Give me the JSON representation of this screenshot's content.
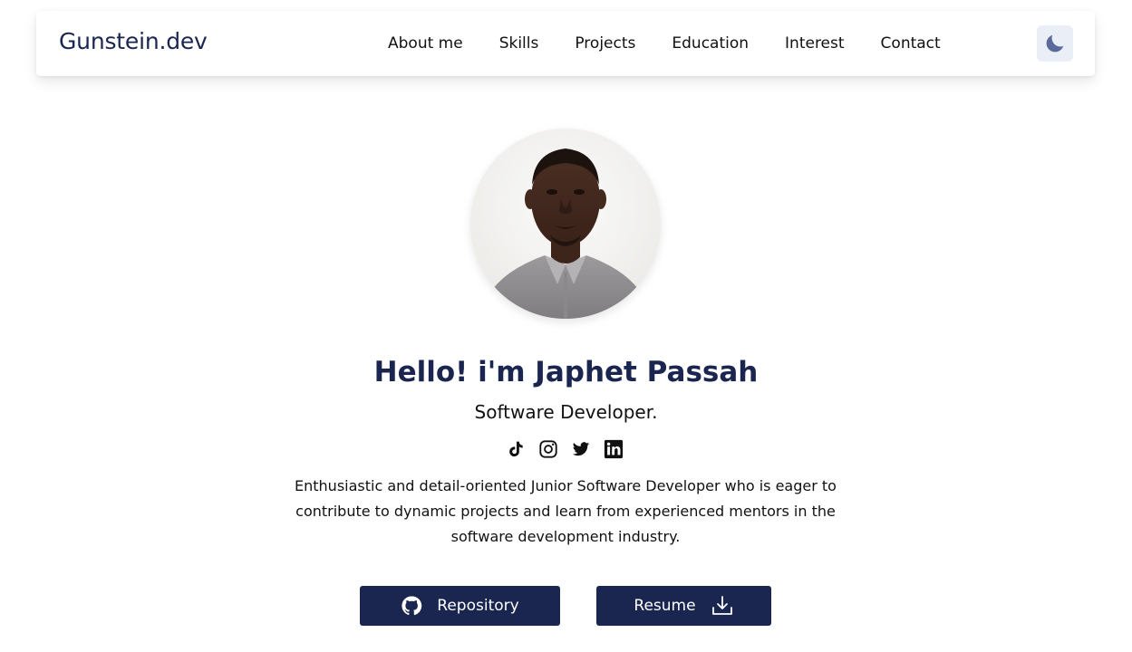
{
  "brand": "Gunstein.dev",
  "nav": {
    "links": [
      "About me",
      "Skills",
      "Projects",
      "Education",
      "Interest",
      "Contact"
    ]
  },
  "theme_toggle": {
    "icon": "moon-icon"
  },
  "hero": {
    "avatar": "profile-photo",
    "title": "Hello! i'm Japhet Passah",
    "subtitle": "Software Developer.",
    "socials": [
      "tiktok-icon",
      "instagram-icon",
      "twitter-icon",
      "linkedin-icon"
    ],
    "bio": "Enthusiastic and detail-oriented Junior Software Developer who is eager to contribute to dynamic projects and learn from experienced mentors in the software development industry."
  },
  "buttons": {
    "repository": "Repository",
    "resume": "Resume"
  },
  "colors": {
    "brand": "#1a2650",
    "toggle_bg": "#e9eef7",
    "moon": "#5a6a9a"
  }
}
